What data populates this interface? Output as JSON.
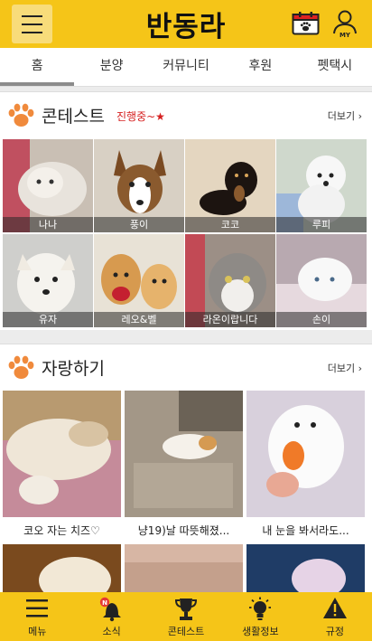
{
  "header": {
    "logo": "반동라",
    "menu_icon": "hamburger-menu-icon",
    "calendar_icon": "paw-calendar-icon",
    "profile_icon": "my-profile-icon",
    "profile_badge": "MY"
  },
  "tabs": [
    {
      "label": "홈",
      "active": true
    },
    {
      "label": "분양",
      "active": false
    },
    {
      "label": "커뮤니티",
      "active": false
    },
    {
      "label": "후원",
      "active": false
    },
    {
      "label": "펫택시",
      "active": false
    }
  ],
  "contest": {
    "title": "콘테스트",
    "status": "진행중~★",
    "more": "더보기 ›",
    "entries": [
      {
        "name": "나나"
      },
      {
        "name": "풍이"
      },
      {
        "name": "코코"
      },
      {
        "name": "루피"
      },
      {
        "name": "유자"
      },
      {
        "name": "레오&벨"
      },
      {
        "name": "라온이랍니다"
      },
      {
        "name": "손이"
      }
    ]
  },
  "brag": {
    "title": "자랑하기",
    "more": "더보기 ›",
    "posts": [
      {
        "title": "코오 자는 치즈♡"
      },
      {
        "title": "냥19)날 따뜻해졌..."
      },
      {
        "title": "내 눈을 봐서라도..."
      }
    ]
  },
  "bottom_nav": [
    {
      "label": "메뉴",
      "icon": "menu-icon"
    },
    {
      "label": "소식",
      "icon": "bell-icon",
      "badge": "N"
    },
    {
      "label": "콘테스트",
      "icon": "trophy-icon"
    },
    {
      "label": "생활정보",
      "icon": "lightbulb-icon"
    },
    {
      "label": "규정",
      "icon": "warning-icon"
    }
  ],
  "colors": {
    "brand": "#f5c518",
    "paw": "#f08a3c",
    "status_red": "#d62020"
  }
}
